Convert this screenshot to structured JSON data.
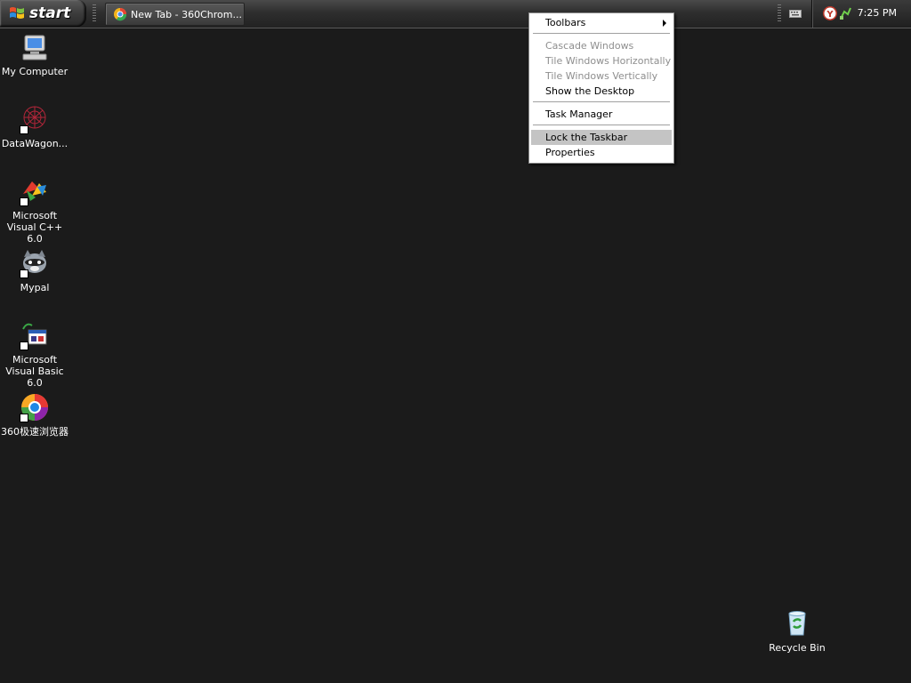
{
  "taskbar": {
    "start_label": "start",
    "task_button_label": "New Tab - 360Chrom...",
    "clock": "7:25 PM",
    "tray_letter": "Y"
  },
  "desktop_icons": [
    {
      "label": "My Computer",
      "icon": "computer-icon"
    },
    {
      "label": "DataWagon...",
      "icon": "datawagon-icon"
    },
    {
      "label": "Microsoft Visual C++ 6.0",
      "icon": "visual-cpp-icon"
    },
    {
      "label": "Mypal",
      "icon": "mypal-icon"
    },
    {
      "label": "Microsoft Visual Basic 6.0",
      "icon": "visual-basic-icon"
    },
    {
      "label": "360极速浏览器",
      "icon": "360-browser-icon"
    },
    {
      "label": "Recycle Bin",
      "icon": "recycle-bin-icon"
    }
  ],
  "context_menu": {
    "toolbars": "Toolbars",
    "cascade": "Cascade Windows",
    "tile_h": "Tile Windows Horizontally",
    "tile_v": "Tile Windows Vertically",
    "show_desktop": "Show the Desktop",
    "task_manager": "Task Manager",
    "lock_taskbar": "Lock the Taskbar",
    "properties": "Properties"
  },
  "colors": {
    "desktop_bg": "#1b1b1b",
    "menu_highlight": "#c4c4c4",
    "menu_disabled_text": "#8e8e8e"
  }
}
